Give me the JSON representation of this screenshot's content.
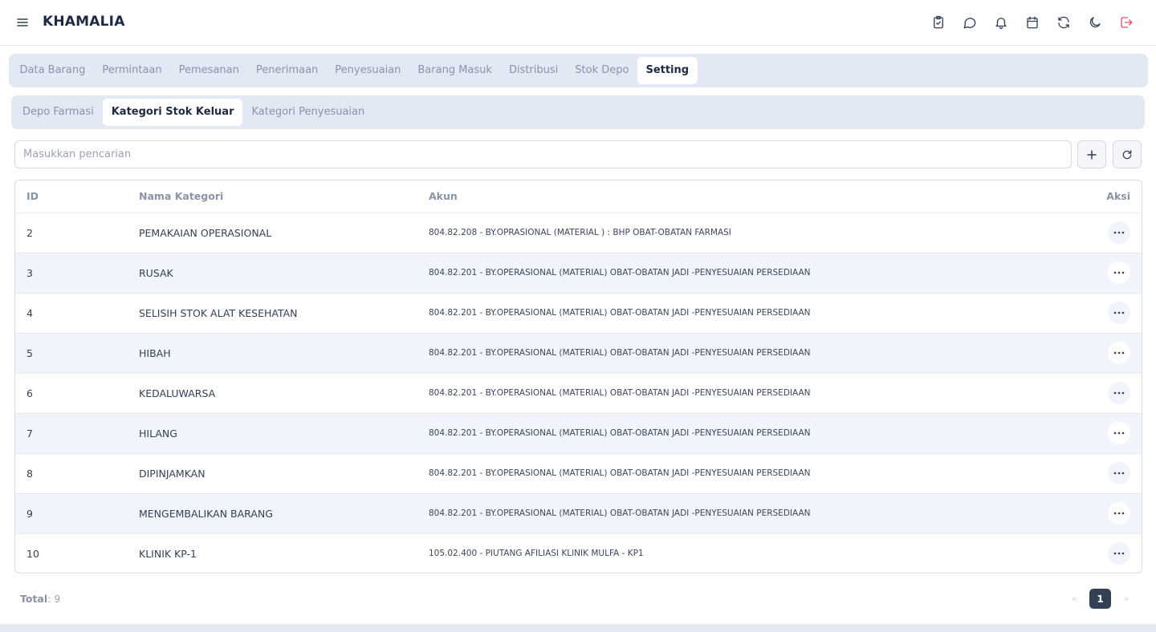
{
  "app": {
    "title": "KHAMALIA"
  },
  "header_icons": [
    "clipboard-check-icon",
    "message-icon",
    "bell-icon",
    "calendar-icon",
    "refresh-icon",
    "moon-icon",
    "logout-icon"
  ],
  "main_tabs": [
    {
      "label": "Data Barang",
      "active": false
    },
    {
      "label": "Permintaan",
      "active": false
    },
    {
      "label": "Pemesanan",
      "active": false
    },
    {
      "label": "Penerimaan",
      "active": false
    },
    {
      "label": "Penyesuaian",
      "active": false
    },
    {
      "label": "Barang Masuk",
      "active": false
    },
    {
      "label": "Distribusi",
      "active": false
    },
    {
      "label": "Stok Depo",
      "active": false
    },
    {
      "label": "Setting",
      "active": true
    }
  ],
  "sub_tabs": [
    {
      "label": "Depo Farmasi",
      "active": false
    },
    {
      "label": "Kategori Stok Keluar",
      "active": true
    },
    {
      "label": "Kategori Penyesuaian",
      "active": false
    }
  ],
  "search": {
    "placeholder": "Masukkan pencarian",
    "value": ""
  },
  "table": {
    "headers": {
      "id": "ID",
      "name": "Nama Kategori",
      "akun": "Akun",
      "aksi": "Aksi"
    },
    "rows": [
      {
        "id": "2",
        "name": "PEMAKAIAN OPERASIONAL",
        "akun": "804.82.208 - BY.OPRASIONAL (MATERIAL ) : BHP OBAT-OBATAN FARMASI"
      },
      {
        "id": "3",
        "name": "RUSAK",
        "akun": "804.82.201 - BY.OPERASIONAL (MATERIAL) OBAT-OBATAN JADI -PENYESUAIAN PERSEDIAAN"
      },
      {
        "id": "4",
        "name": "SELISIH STOK ALAT KESEHATAN",
        "akun": "804.82.201 - BY.OPERASIONAL (MATERIAL) OBAT-OBATAN JADI -PENYESUAIAN PERSEDIAAN"
      },
      {
        "id": "5",
        "name": "HIBAH",
        "akun": "804.82.201 - BY.OPERASIONAL (MATERIAL) OBAT-OBATAN JADI -PENYESUAIAN PERSEDIAAN"
      },
      {
        "id": "6",
        "name": "KEDALUWARSA",
        "akun": "804.82.201 - BY.OPERASIONAL (MATERIAL) OBAT-OBATAN JADI -PENYESUAIAN PERSEDIAAN"
      },
      {
        "id": "7",
        "name": "HILANG",
        "akun": "804.82.201 - BY.OPERASIONAL (MATERIAL) OBAT-OBATAN JADI -PENYESUAIAN PERSEDIAAN"
      },
      {
        "id": "8",
        "name": "DIPINJAMKAN",
        "akun": "804.82.201 - BY.OPERASIONAL (MATERIAL) OBAT-OBATAN JADI -PENYESUAIAN PERSEDIAAN"
      },
      {
        "id": "9",
        "name": "MENGEMBALIKAN BARANG",
        "akun": "804.82.201 - BY.OPERASIONAL (MATERIAL) OBAT-OBATAN JADI -PENYESUAIAN PERSEDIAAN"
      },
      {
        "id": "10",
        "name": "KLINIK KP-1",
        "akun": "105.02.400 - PIUTANG AFILIASI KLINIK MULFA - KP1"
      }
    ]
  },
  "footer": {
    "total_label": "Total",
    "total_value": ": 9",
    "pagination": {
      "prev": "«",
      "current": "1",
      "next": "»"
    }
  },
  "colors": {
    "logout": "#e05260",
    "accent": "#334155",
    "tab_bg": "#e2e8f4"
  }
}
